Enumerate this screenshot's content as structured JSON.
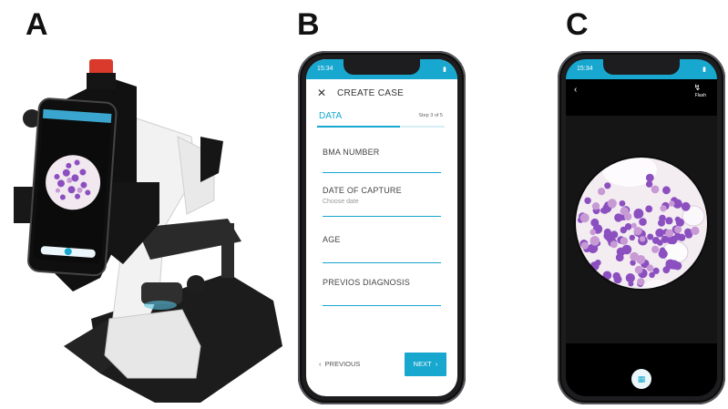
{
  "panels": {
    "a_label": "A",
    "b_label": "B",
    "c_label": "C"
  },
  "phone_b": {
    "status_time": "15:34",
    "header_title": "CREATE CASE",
    "tab_label": "DATA",
    "step_text": "Step 3 of 5",
    "progress": 0.65,
    "fields": [
      {
        "label": "BMA NUMBER",
        "placeholder": ""
      },
      {
        "label": "DATE OF CAPTURE",
        "placeholder": "Choose date"
      },
      {
        "label": "AGE",
        "placeholder": ""
      },
      {
        "label": "PREVIOS DIAGNOSIS",
        "placeholder": ""
      }
    ],
    "prev_label": "PREVIOUS",
    "next_label": "NEXT",
    "accent_color": "#17a7cf"
  },
  "phone_c": {
    "status_time": "15:34",
    "flash_label": "Flash"
  },
  "colors": {
    "cell_purple": "#8b4fc0",
    "cell_pink": "#c79ad6",
    "stage_black": "#1a1a1a"
  }
}
